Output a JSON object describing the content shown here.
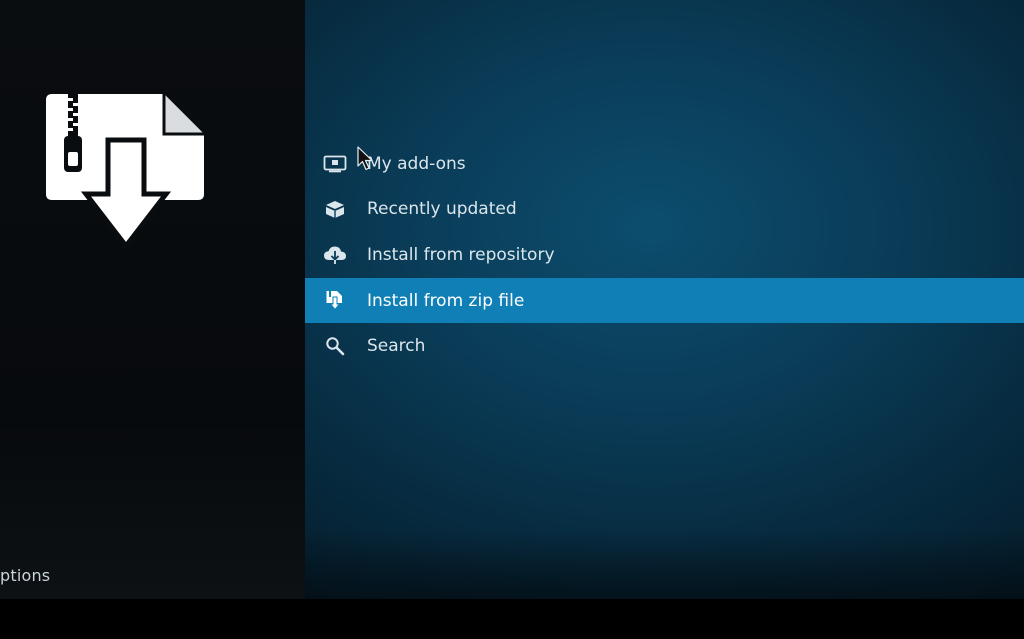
{
  "sidebar": {
    "options_label": "ptions",
    "feature_icon": "zip-file-download-icon"
  },
  "menu": {
    "items": [
      {
        "label": "My add-ons",
        "icon": "monitor-icon",
        "focused": false
      },
      {
        "label": "Recently updated",
        "icon": "open-box-icon",
        "focused": false
      },
      {
        "label": "Install from repository",
        "icon": "cloud-download-icon",
        "focused": false
      },
      {
        "label": "Install from zip file",
        "icon": "zip-install-icon",
        "focused": true
      },
      {
        "label": "Search",
        "icon": "search-icon",
        "focused": false
      }
    ]
  },
  "colors": {
    "focus_highlight": "#0f7fb5",
    "main_background": "#0a3d59",
    "sidebar_background": "#0a0d10"
  }
}
